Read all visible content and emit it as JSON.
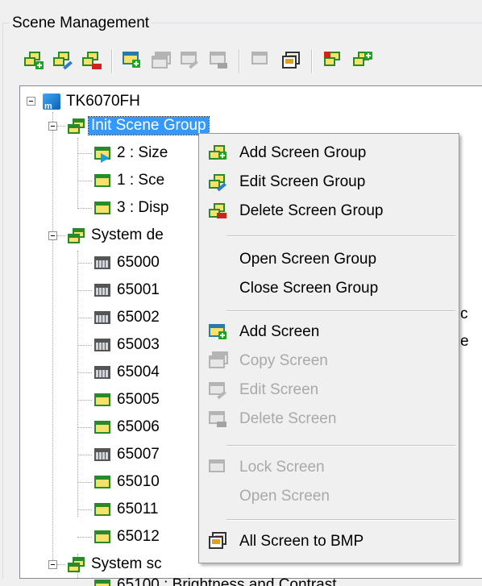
{
  "panel": {
    "title": "Scene Management"
  },
  "toolbar": {
    "buttons": [
      {
        "icon": "add-screen-group-icon"
      },
      {
        "icon": "edit-screen-group-icon"
      },
      {
        "icon": "delete-screen-group-icon"
      },
      {
        "icon": "add-screen-icon"
      },
      {
        "icon": "copy-screen-icon"
      },
      {
        "icon": "edit-screen-icon"
      },
      {
        "icon": "delete-screen-icon"
      },
      {
        "icon": "lock-screen-icon"
      },
      {
        "icon": "all-screen-to-bmp-icon"
      },
      {
        "icon": "open-screen-group-icon"
      },
      {
        "icon": "close-screen-group-icon"
      }
    ]
  },
  "tree": {
    "root": {
      "label": "TK6070FH",
      "icon": "project-icon"
    },
    "groups": [
      {
        "label": "Init Scene Group",
        "selected": true,
        "screens": [
          {
            "label": "2 : Size",
            "icon": "startup-screen-icon"
          },
          {
            "label": "1 : Sce",
            "icon": "screen-icon"
          },
          {
            "label": "3 : Disp",
            "icon": "screen-icon"
          }
        ]
      },
      {
        "label": "System de",
        "screens": [
          {
            "label": "65000",
            "icon": "system-screen-icon"
          },
          {
            "label": "65001",
            "icon": "system-screen-icon"
          },
          {
            "label": "65002",
            "icon": "system-screen-icon"
          },
          {
            "label": "65003",
            "icon": "system-screen-icon"
          },
          {
            "label": "65004",
            "icon": "system-screen-icon"
          },
          {
            "label": "65005",
            "icon": "screen-icon"
          },
          {
            "label": "65006",
            "icon": "screen-icon"
          },
          {
            "label": "65007",
            "icon": "system-screen-icon"
          },
          {
            "label": "65010",
            "icon": "screen-icon"
          },
          {
            "label": "65011",
            "icon": "screen-icon"
          },
          {
            "label": "65012",
            "icon": "screen-icon"
          }
        ]
      },
      {
        "label": "System sc",
        "screens": [
          {
            "label": "65100 : Brightness and Contrast",
            "icon": "screen-icon"
          }
        ]
      }
    ],
    "overflow_text": [
      "c",
      "e"
    ]
  },
  "context_menu": {
    "items": [
      {
        "label": "Add Screen Group",
        "enabled": true,
        "icon": "add-screen-group-icon"
      },
      {
        "label": "Edit Screen Group",
        "enabled": true,
        "icon": "edit-screen-group-icon"
      },
      {
        "label": "Delete Screen Group",
        "enabled": true,
        "icon": "delete-screen-group-icon"
      },
      {
        "label": "Open Screen Group",
        "enabled": true,
        "icon": ""
      },
      {
        "label": "Close Screen Group",
        "enabled": true,
        "icon": ""
      },
      {
        "label": "Add Screen",
        "enabled": true,
        "icon": "add-screen-icon"
      },
      {
        "label": "Copy Screen",
        "enabled": false,
        "icon": "copy-screen-icon"
      },
      {
        "label": "Edit Screen",
        "enabled": false,
        "icon": "edit-screen-icon"
      },
      {
        "label": "Delete Screen",
        "enabled": false,
        "icon": "delete-screen-icon"
      },
      {
        "label": "Lock Screen",
        "enabled": false,
        "icon": "lock-screen-icon"
      },
      {
        "label": "Open Screen",
        "enabled": false,
        "icon": ""
      },
      {
        "label": "All Screen to BMP",
        "enabled": true,
        "icon": "all-screen-to-bmp-icon"
      }
    ]
  },
  "colors": {
    "selection": "#3399ff",
    "disabled_text": "#a9a9a9",
    "screen_fill": "#f6e26a",
    "screen_border": "#2a8a2a"
  }
}
